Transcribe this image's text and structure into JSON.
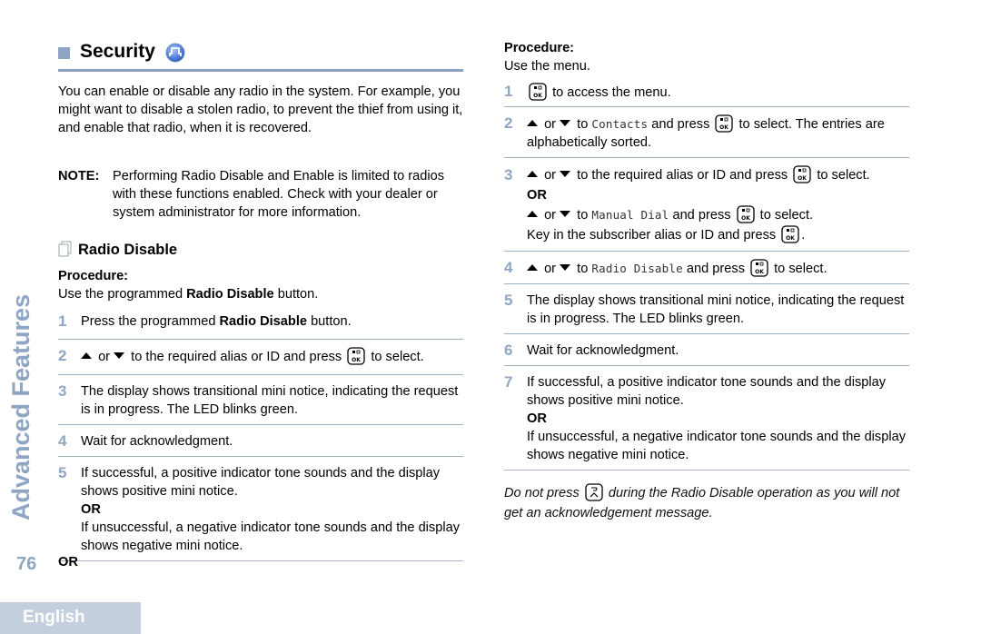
{
  "side_tab": {
    "section": "Advanced Features",
    "page_number": "76",
    "language": "English"
  },
  "colors": {
    "accent": "#8ea6c4",
    "rule": "#8aa2bf",
    "divider": "#9cb0c2",
    "language_tab_bg": "#c3cfdd"
  },
  "section": {
    "title": "Security",
    "icon": "system-feature-icon",
    "intro": "You can enable or disable any radio in the system. For example, you might want to disable a stolen radio, to prevent the thief from using it, and enable that radio, when it is recovered.",
    "note_label": "NOTE:",
    "note_text": "Performing Radio Disable and Enable is limited to radios with these functions enabled. Check with your dealer or system administrator for more information."
  },
  "subsection": {
    "title": "Radio Disable",
    "icon": "pages-icon"
  },
  "left_procedure": {
    "label": "Procedure:",
    "intro_pre": "Use the programmed ",
    "intro_bold": "Radio Disable",
    "intro_post": " button.",
    "steps": [
      {
        "num": "1",
        "pre": "Press the programmed ",
        "bold": "Radio Disable",
        "post": " button."
      },
      {
        "num": "2",
        "or": "or",
        "text": "to the required alias or ID and press",
        "post": "to select."
      },
      {
        "num": "3",
        "text": "The display shows transitional mini notice, indicating the request is in progress. The LED blinks green."
      },
      {
        "num": "4",
        "text": "Wait for acknowledgment."
      },
      {
        "num": "5",
        "text1": "If successful, a positive indicator tone sounds and the display shows positive mini notice.",
        "or": "OR",
        "text2": "If unsuccessful, a negative indicator tone sounds and the display shows negative mini notice."
      }
    ],
    "trailing_or": "OR"
  },
  "right_procedure": {
    "label": "Procedure:",
    "intro": "Use the menu.",
    "steps": [
      {
        "num": "1",
        "post": "to access the menu."
      },
      {
        "num": "2",
        "or": "or",
        "to": "to",
        "menu": "Contacts",
        "mid": "and press",
        "post": "to select. The entries are alphabetically sorted."
      },
      {
        "num": "3",
        "or": "or",
        "text": "to the required alias or ID and press",
        "post": "to select.",
        "or_label": "OR",
        "to": "to",
        "menu": "Manual Dial",
        "mid": "and press",
        "post2": "to select.",
        "key_in": "Key in the subscriber alias or ID and press",
        "key_in_end": "."
      },
      {
        "num": "4",
        "or": "or",
        "to": "to",
        "menu": "Radio Disable",
        "mid": "and press",
        "post": "to select."
      },
      {
        "num": "5",
        "text": "The display shows transitional mini notice, indicating the request is in progress. The LED blinks green."
      },
      {
        "num": "6",
        "text": "Wait for acknowledgment."
      },
      {
        "num": "7",
        "text1": "If successful, a positive indicator tone sounds and the display shows positive mini notice.",
        "or": "OR",
        "text2": "If unsuccessful, a negative indicator tone sounds and the display shows negative mini notice."
      }
    ],
    "warning_pre": "Do not press",
    "warning_icon": "back-home-button-icon",
    "warning_post": "during the Radio Disable operation as you will not get an acknowledgement message."
  },
  "icons": {
    "ok_button": "menu-ok-button-icon",
    "up": "arrow-up-icon",
    "down": "arrow-down-icon"
  }
}
